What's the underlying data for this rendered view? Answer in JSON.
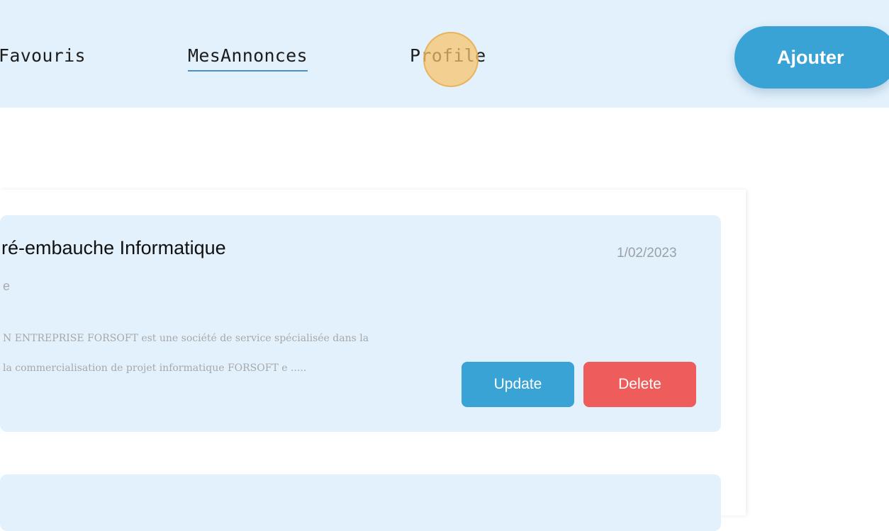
{
  "nav": {
    "items": [
      {
        "label": "Favouris"
      },
      {
        "label": "MesAnnonces"
      },
      {
        "label": "Profile"
      }
    ],
    "add_button": "Ajouter"
  },
  "annonce": {
    "title": "ré-embauche Informatique",
    "date": "1/02/2023",
    "subtitle": "e",
    "description_line1": "N ENTREPRISE FORSOFT est une société de service spécialisée dans la",
    "description_line2": "la commercialisation de projet informatique FORSOFT e .....",
    "update_label": "Update",
    "delete_label": "Delete"
  },
  "colors": {
    "navbar_bg": "#e3f1fc",
    "accent": "#3aa3d6",
    "danger": "#ef5c5c"
  }
}
